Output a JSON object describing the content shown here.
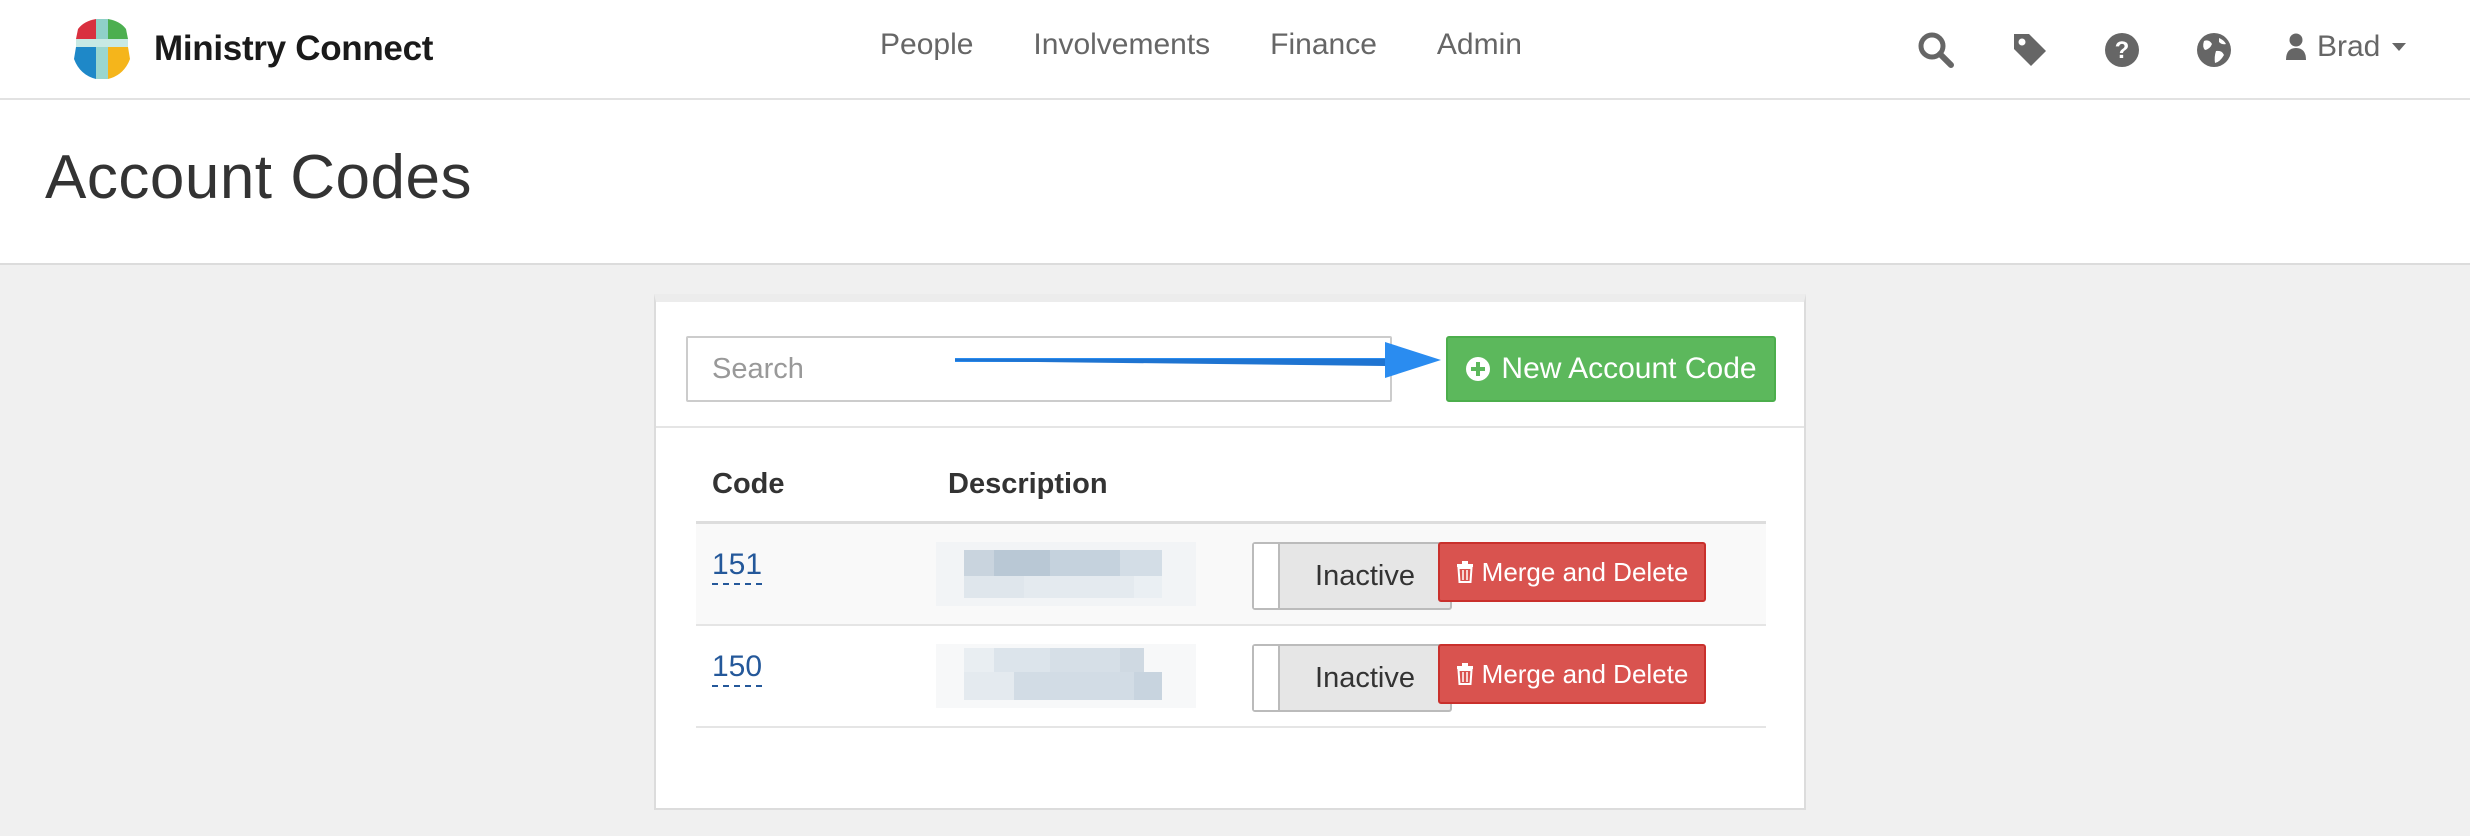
{
  "navbar": {
    "brand_name": "Ministry Connect",
    "links": [
      "People",
      "Involvements",
      "Finance",
      "Admin"
    ],
    "icons": [
      "search-icon",
      "tag-icon",
      "help-icon",
      "globe-icon"
    ],
    "user": {
      "name": "Brad",
      "icon": "user-icon",
      "caret": "caret-down-icon"
    }
  },
  "page": {
    "title": "Account Codes"
  },
  "toolbar": {
    "search_placeholder": "Search",
    "new_button_label": "New Account Code",
    "new_button_icon": "plus-circle-icon"
  },
  "table": {
    "columns": [
      "Code",
      "Description"
    ],
    "rows": [
      {
        "code": "151",
        "status": "Inactive",
        "action": "Merge and Delete"
      },
      {
        "code": "150",
        "status": "Inactive",
        "action": "Merge and Delete"
      }
    ]
  },
  "colors": {
    "success": "#5cb85c",
    "danger": "#d9534f",
    "link": "#24589a",
    "annotation_arrow": "#2a8cf0"
  }
}
